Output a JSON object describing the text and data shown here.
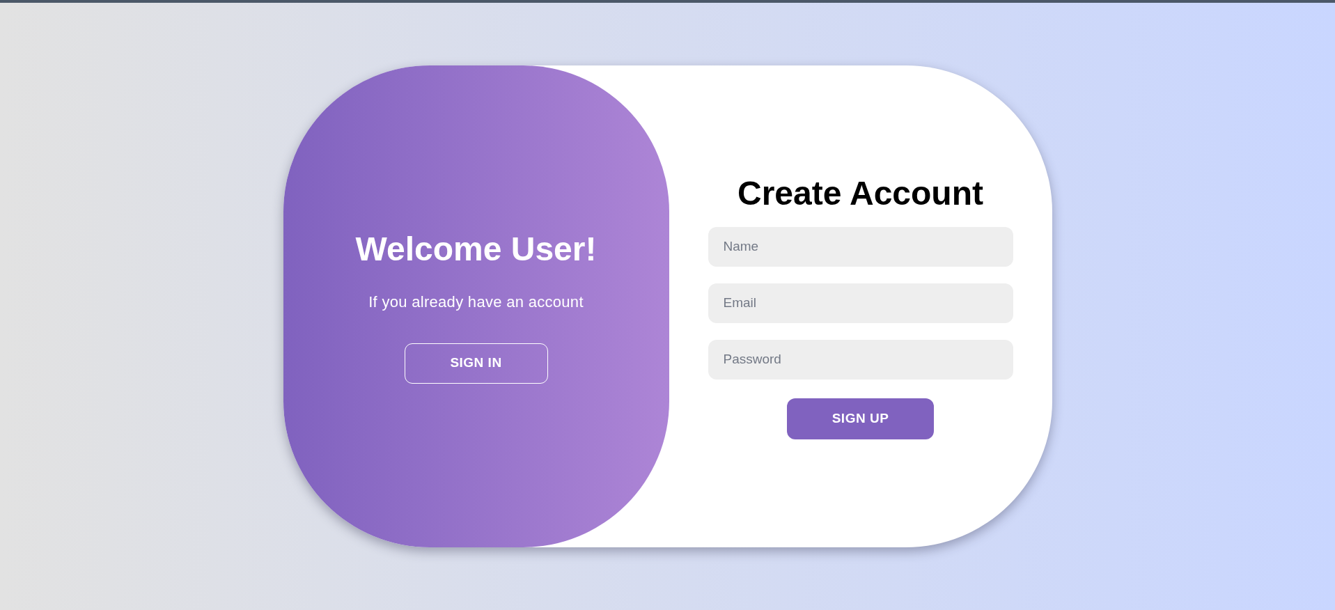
{
  "welcome_panel": {
    "title": "Welcome User!",
    "text": "If you already have an account",
    "button": "SIGN IN"
  },
  "signup_form": {
    "title": "Create Account",
    "fields": [
      {
        "placeholder": "Name"
      },
      {
        "placeholder": "Email"
      },
      {
        "placeholder": "Password"
      }
    ],
    "button": "SIGN UP"
  }
}
